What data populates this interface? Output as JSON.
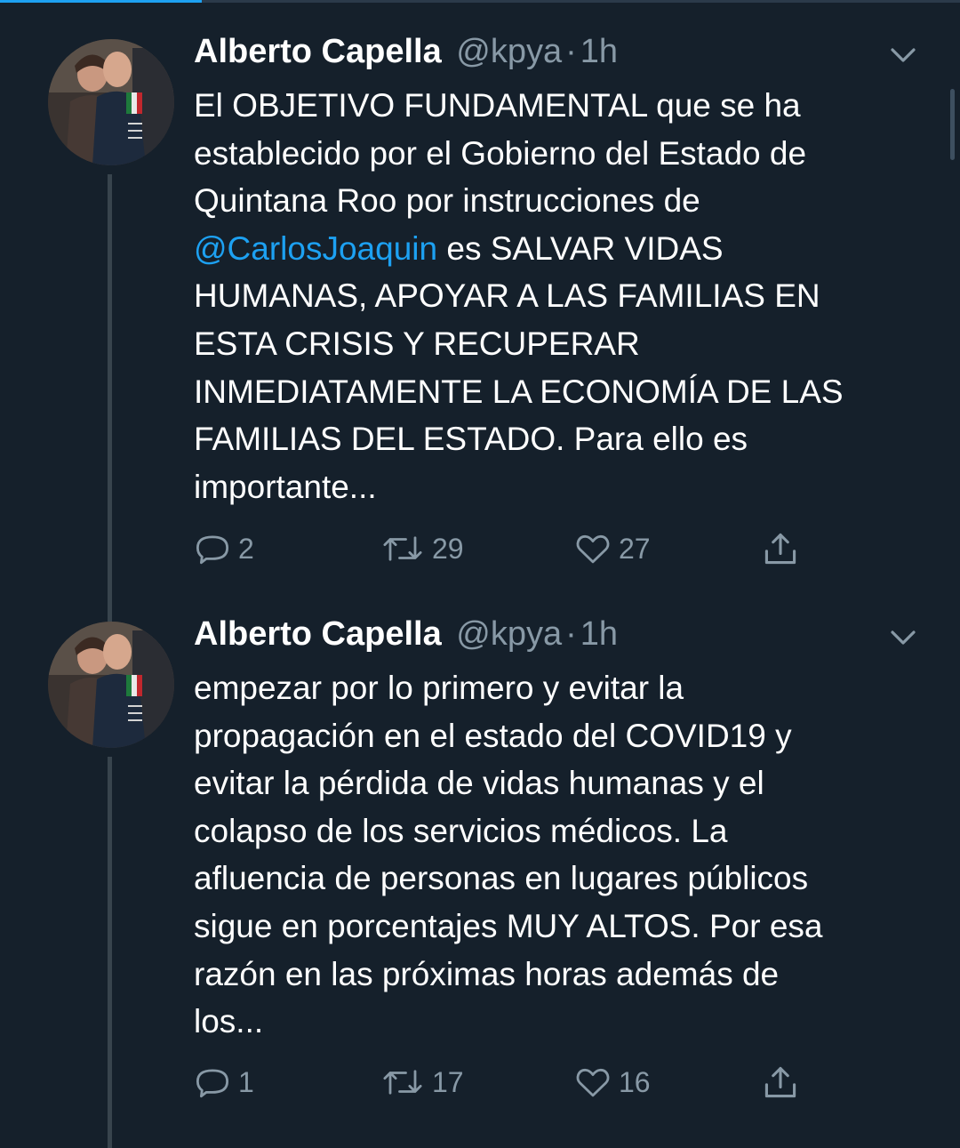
{
  "top_progress": {
    "value": 0.21
  },
  "tweets": [
    {
      "author": "Alberto Capella",
      "handle": "@kpya",
      "separator": "·",
      "time": "1h",
      "text_before": "El OBJETIVO FUNDAMENTAL que se ha\nestablecido por el Gobierno del Estado de\nQuintana Roo por instrucciones de\n",
      "mention": "@CarlosJoaquin",
      "text_after": " es SALVAR VIDAS\nHUMANAS, APOYAR A LAS FAMILIAS EN\nESTA CRISIS Y RECUPERAR\nINMEDIATAMENTE LA ECONOMÍA DE LAS\nFAMILIAS DEL ESTADO. Para ello es\nimportante...",
      "replies": "2",
      "retweets": "29",
      "likes": "27"
    },
    {
      "author": "Alberto Capella",
      "handle": "@kpya",
      "separator": "·",
      "time": "1h",
      "text_before": "empezar por lo primero y evitar la\npropagación en el estado del COVID19 y\nevitar la pérdida de vidas humanas y el\ncolapso de los servicios médicos. La\nafluencia de personas en lugares públicos\nsigue en porcentajes MUY ALTOS. Por esa\nrazón en las próximas horas además de\nlos...",
      "mention": "",
      "text_after": "",
      "replies": "1",
      "retweets": "17",
      "likes": "16"
    }
  ],
  "colors": {
    "background": "#15202b",
    "accent": "#1da1f2",
    "secondary_text": "#8899a6"
  },
  "icons": [
    "chevron-down-icon",
    "reply-icon",
    "retweet-icon",
    "like-icon",
    "share-icon"
  ]
}
